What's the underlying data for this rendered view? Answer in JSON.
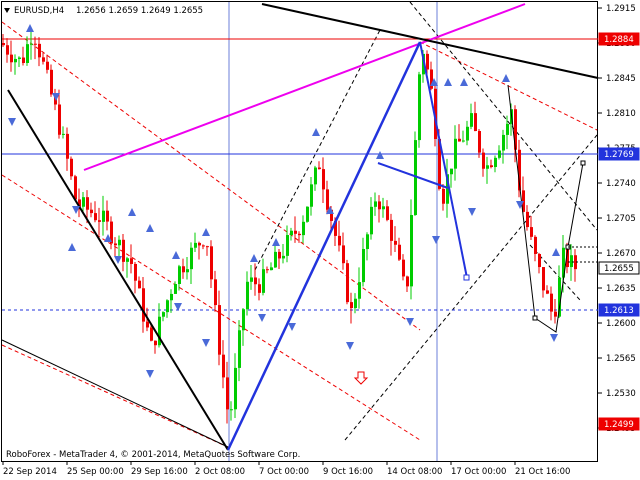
{
  "header": {
    "symbol": "EURUSD,H4",
    "ohlc": "1.2656 1.2659 1.2649 1.2655"
  },
  "footer": {
    "copyright": "RoboForex - MetaTrader 4, © 2001-2014, MetaQuotes Software Corp."
  },
  "colors": {
    "bull": "#00cc00",
    "bear": "#ee0000",
    "impulse": "#2233dd",
    "channel": "#ee00ee",
    "level": "#2233dd",
    "resistance": "#ee0000",
    "label_bg": "#ee0000",
    "label_text": "#ffffff"
  },
  "chart_data": {
    "type": "candlestick",
    "ylim": [
      1.2485,
      1.2925
    ],
    "y_ticks": [
      "1.2915",
      "1.2880",
      "1.2845",
      "1.2810",
      "1.2775",
      "1.2740",
      "1.2705",
      "1.2670",
      "1.2635",
      "1.2600",
      "1.2565",
      "1.2530",
      "1.2495"
    ],
    "x_ticks": [
      "22 Sep 2014",
      "25 Sep 00:00",
      "29 Sep 16:00",
      "2 Oct 08:00",
      "7 Oct 00:00",
      "9 Oct 16:00",
      "14 Oct 08:00",
      "17 Oct 00:00",
      "21 Oct 16:00"
    ],
    "price_labels": [
      {
        "value": "1.2884",
        "price": 1.2884,
        "style": "red"
      },
      {
        "value": "1.2769",
        "price": 1.2769,
        "style": "blue"
      },
      {
        "value": "1.2655",
        "price": 1.2655,
        "style": "white"
      },
      {
        "value": "1.2613",
        "price": 1.2613,
        "style": "blue"
      },
      {
        "value": "1.2499",
        "price": 1.2499,
        "style": "red"
      }
    ],
    "horizontal_levels": [
      {
        "price": 1.2884,
        "color": "#ee0000",
        "style": "solid"
      },
      {
        "price": 1.2769,
        "color": "#2233dd",
        "style": "solid"
      },
      {
        "price": 1.2613,
        "color": "#2233dd",
        "style": "dashed"
      }
    ],
    "key_points": [
      {
        "name": "start",
        "price": 1.288
      },
      {
        "name": "low_1",
        "price": 1.2499
      },
      {
        "name": "high_1",
        "price": 1.2884
      },
      {
        "name": "low_2",
        "price": 1.2605
      },
      {
        "name": "last_close",
        "price": 1.2655
      }
    ]
  }
}
